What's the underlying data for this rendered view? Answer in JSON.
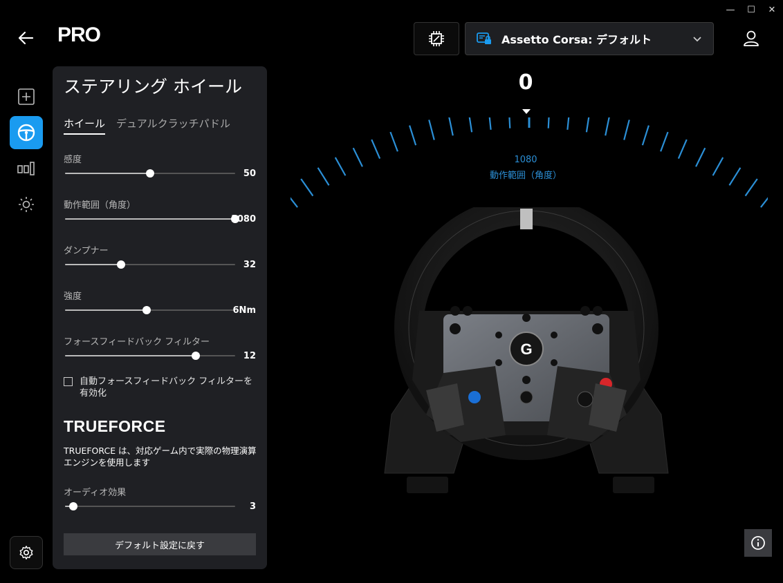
{
  "window": {
    "minimize": "—",
    "maximize": "☐",
    "close": "✕"
  },
  "app": {
    "title": "PRO"
  },
  "header": {
    "profile_name": "Assetto Corsa: デフォルト"
  },
  "panel": {
    "title": "ステアリング ホイール",
    "tabs": [
      {
        "label": "ホイール",
        "active": true
      },
      {
        "label": "デュアルクラッチパドル",
        "active": false
      }
    ],
    "settings": [
      {
        "label": "感度",
        "value": "50",
        "fraction": 0.5
      },
      {
        "label": "動作範囲（角度）",
        "value": "1080",
        "fraction": 1.0
      },
      {
        "label": "ダンプナー",
        "value": "32",
        "fraction": 0.33
      },
      {
        "label": "強度",
        "value": "6Nm",
        "fraction": 0.48
      },
      {
        "label": "フォースフィードバック フィルター",
        "value": "12",
        "fraction": 0.77
      }
    ],
    "auto_filter_label": "自動フォースフィードバック フィルターを有効化",
    "auto_filter_checked": false,
    "trueforce_logo": "TRUEFORCE",
    "trueforce_desc": "TRUEFORCE は、対応ゲーム内で実際の物理演算エンジンを使用します",
    "audio": {
      "label": "オーディオ効果",
      "value": "3",
      "fraction": 0.05
    },
    "reset_label": "デフォルト設定に戻す"
  },
  "display": {
    "angle": "0",
    "range_value": "1080",
    "range_label": "動作範囲（角度）"
  },
  "colors": {
    "accent": "#1a9bf0",
    "gauge": "#2b8fd6"
  },
  "icons": [
    "back-arrow-icon",
    "chip-icon",
    "profile-lock-icon",
    "chevron-down-icon",
    "user-icon",
    "plus-icon",
    "steering-wheel-icon",
    "pedals-icon",
    "brightness-icon",
    "gear-icon",
    "info-icon"
  ]
}
